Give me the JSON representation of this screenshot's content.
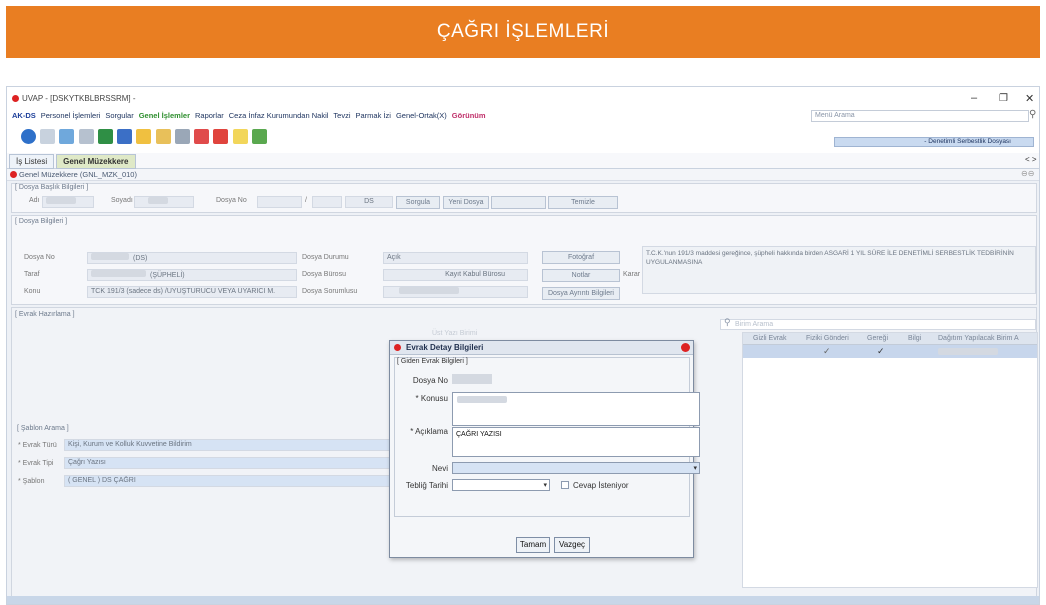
{
  "banner": {
    "title": "ÇAĞRI İŞLEMLERİ"
  },
  "window": {
    "title": "UVAP - [DSKYTKBLBRSSRM] -",
    "controls": {
      "minimize": "–",
      "maximize": "❐",
      "close": "✕"
    }
  },
  "menu": {
    "items": [
      "AK-DS",
      "Personel İşlemleri",
      "Sorgular",
      "Genel İşlemler",
      "Raporlar",
      "Ceza İnfaz Kurumundan Nakil",
      "Tevzi",
      "Parmak İzi",
      "Genel-Ortak(X)",
      "Görünüm"
    ],
    "search_placeholder": "Menü Arama",
    "dossier_type": "- Denetimli Serbestlik Dosyası"
  },
  "tabs": [
    "İş Listesi",
    "Genel Müzekkere"
  ],
  "form": {
    "title": "Genel Müzekkere (GNL_MZK_010)",
    "arrows": "< >",
    "dosya_basvuru": {
      "legend": "[ Dosya Başlık Bilgileri ]",
      "adi": "Adı",
      "soyadi": "Soyadı",
      "dosya_no": "Dosya No",
      "slash": "/",
      "ds": "DS",
      "sorgula": "Sorgula",
      "yeni_dosya": "Yeni Dosya",
      "temizle": "Temizle"
    },
    "dosya_bilgileri": {
      "legend": "[ Dosya Bilgileri ]",
      "dosya_no_label": "Dosya No",
      "dosya_no_value": "(DS)",
      "taraf_label": "Taraf",
      "taraf_value": "(ŞÜPHELİ)",
      "konu_label": "Konu",
      "konu_value": "TCK 191/3 (sadece ds) /UYUŞTURUCU VEYA UYARICI M.",
      "dosya_durumu": "Dosya Durumu",
      "dosya_burosu": "Dosya Bürosu",
      "dosya_sorumlusu": "Dosya Sorumlusu",
      "acik": "Açık",
      "kayit_kabul": "Kayıt Kabul Bürosu",
      "fotograf": "Fotoğraf",
      "notlar": "Notlar",
      "karar_label": "Karar",
      "dosya_ayrinti": "Dosya Ayrıntı Bilgileri",
      "karar_text": "T.C.K.'nun 191/3 maddesi gereğince, şüpheli hakkında birden ASGARİ 1 YIL SÜRE İLE DENETİMLİ SERBESTLİK TEDBİRİNİN UYGULANMASINA"
    },
    "evrak_hazirlama": {
      "legend": "[ Evrak Hazırlama ]"
    },
    "sablon_arama": {
      "legend": "[ Şablon Arama ]",
      "evrak_turu_label": "* Evrak Türü",
      "evrak_turu_value": "Kişi, Kurum ve Kolluk Kuvvetine Bildirim",
      "evrak_tipi_label": "* Evrak Tipi",
      "evrak_tipi_value": "Çağrı Yazısı",
      "sablon_label": "* Şablon",
      "sablon_value": "( GENEL ) DS ÇAĞRI"
    },
    "birim_arama": {
      "placeholder": "Birim Arama",
      "columns": [
        "Gizli Evrak",
        "Fiziki Gönderi",
        "Gereği",
        "Bilgi",
        "Dağıtım Yapılacak Birim A"
      ]
    },
    "ust_yazi_birimi": "Üst Yazı Birimi"
  },
  "dialog": {
    "title": "Evrak Detay Bilgileri",
    "legend": "[ Giden Evrak Bilgileri ]",
    "dosya_no_label": "Dosya No",
    "konusu_label": "* Konusu",
    "aciklama_label": "* Açıklama",
    "aciklama_value": "ÇAĞRI YAZISI",
    "nevi_label": "Nevi",
    "tebligat_label": "Tebliğ Tarihi",
    "cevap_label": "Cevap İsteniyor",
    "ok_label": "Tamam",
    "cancel_label": "Vazgeç"
  },
  "colors": {
    "banner": "#e97e22",
    "frame": "#eef1f6"
  }
}
